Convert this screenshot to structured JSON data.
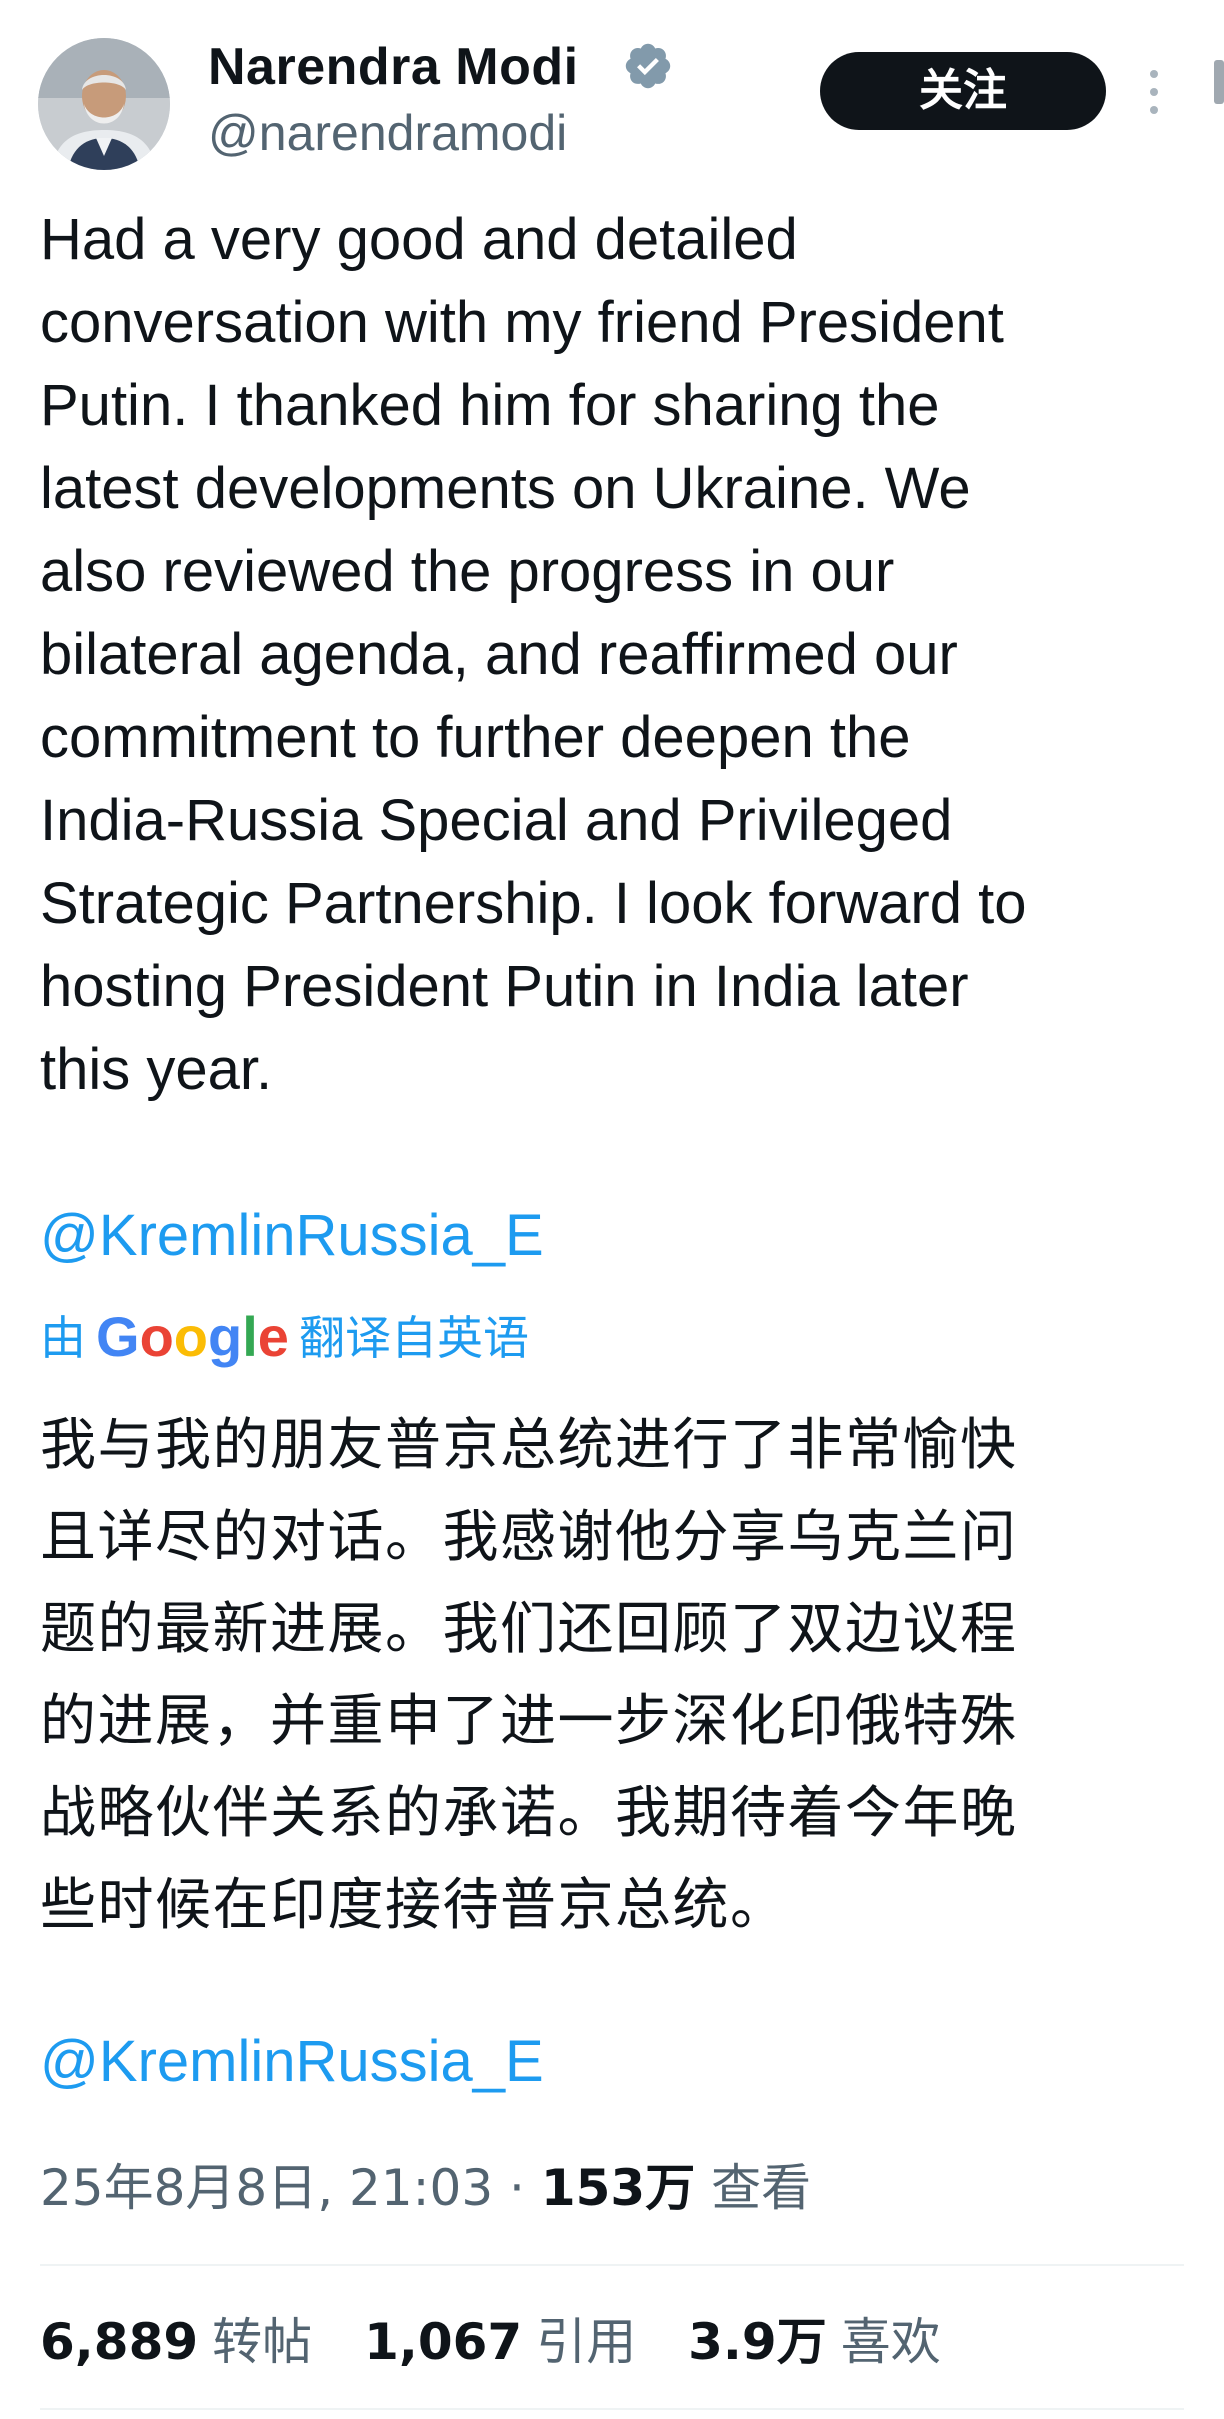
{
  "author": {
    "display_name": "Narendra Modi",
    "handle": "@narendramodi"
  },
  "actions": {
    "follow_label": "关注"
  },
  "tweet": {
    "text": "Had a very good and detailed\nconversation with my friend President\nPutin. I thanked him for sharing the\nlatest developments on Ukraine. We\nalso reviewed the progress in our\nbilateral agenda, and reaffirmed our\ncommitment to further deepen the\nIndia-Russia Special and Privileged\nStrategic Partnership. I look forward to\nhosting President Putin in India later\nthis year.",
    "mention": "@KremlinRussia_E"
  },
  "translation": {
    "prefix": "由",
    "provider": "Google",
    "suffix": "翻译自英语",
    "text": "我与我的朋友普京总统进行了非常愉快\n且详尽的对话。我感谢他分享乌克兰问\n题的最新进展。我们还回顾了双边议程\n的进展，并重申了进一步深化印俄特殊\n战略伙伴关系的承诺。我期待着今年晚\n些时候在印度接待普京总统。",
    "mention": "@KremlinRussia_E"
  },
  "meta": {
    "timestamp": "25年8月8日, 21:03",
    "separator": "·",
    "views_count": "153万",
    "views_label": "查看"
  },
  "stats": {
    "reposts_count": "6,889",
    "reposts_label": "转帖",
    "quotes_count": "1,067",
    "quotes_label": "引用",
    "likes_count": "3.9万",
    "likes_label": "喜欢"
  },
  "icons": {
    "avatar": "profile-photo",
    "verified": "verified-badge-icon",
    "more": "more-vertical-icon"
  },
  "colors": {
    "text": "#0f1419",
    "secondary": "#536471",
    "link": "#1d9bf0",
    "verified_badge": "#829aab",
    "button_bg": "#0f1419",
    "button_text": "#ffffff"
  }
}
